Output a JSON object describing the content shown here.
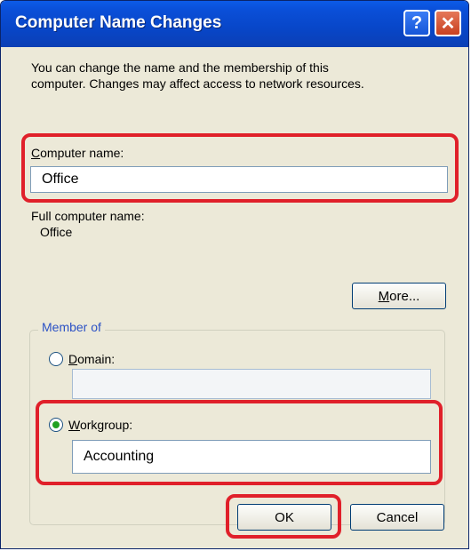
{
  "window": {
    "title": "Computer Name Changes",
    "help_label": "?",
    "close_label": "✕"
  },
  "description": {
    "line1": "You can change the name and the membership of this",
    "line2": "computer. Changes may affect access to network resources."
  },
  "computer_name": {
    "label_accel": "C",
    "label_rest": "omputer name:",
    "value": "Office"
  },
  "full_computer_name": {
    "label": "Full computer name:",
    "value": "Office"
  },
  "more_button": {
    "accel": "M",
    "rest": "ore..."
  },
  "member_of": {
    "legend": "Member of",
    "domain": {
      "accel": "D",
      "rest": "omain:",
      "value": "",
      "selected": false
    },
    "workgroup": {
      "accel": "W",
      "rest": "orkgroup:",
      "value": "Accounting",
      "selected": true
    }
  },
  "buttons": {
    "ok": "OK",
    "cancel": "Cancel"
  },
  "colors": {
    "highlight": "#e0202a",
    "titlebar": "#0a4fd8",
    "dialog_bg": "#ece9d8"
  }
}
